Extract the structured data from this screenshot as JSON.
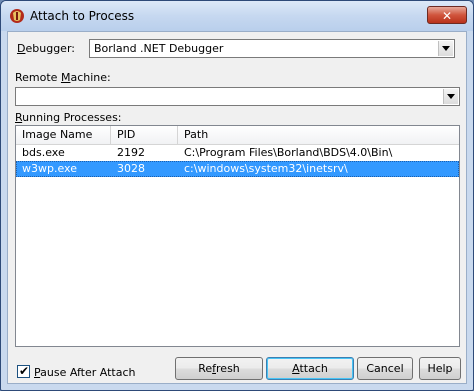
{
  "window": {
    "title": "Attach to Process",
    "close_glyph": "✕"
  },
  "debugger": {
    "label_prefix": "",
    "label_underline": "D",
    "label_rest": "ebugger:",
    "value": "Borland .NET Debugger"
  },
  "remote": {
    "label_prefix": "Remote ",
    "label_underline": "M",
    "label_rest": "achine:",
    "value": ""
  },
  "processes": {
    "label_prefix": "",
    "label_underline": "R",
    "label_rest": "unning Processes:",
    "columns": [
      "Image Name",
      "PID",
      "Path"
    ],
    "rows": [
      {
        "name": "bds.exe",
        "pid": "2192",
        "path": "C:\\Program Files\\Borland\\BDS\\4.0\\Bin\\",
        "selected": false
      },
      {
        "name": "w3wp.exe",
        "pid": "3028",
        "path": "c:\\windows\\system32\\inetsrv\\",
        "selected": true
      }
    ]
  },
  "pause": {
    "checked": true,
    "check_glyph": "✔",
    "label_prefix": "",
    "label_underline": "P",
    "label_rest": "ause After Attach"
  },
  "buttons": {
    "refresh": {
      "prefix": "Re",
      "underline": "f",
      "rest": "resh"
    },
    "attach": {
      "prefix": "",
      "underline": "A",
      "rest": "ttach"
    },
    "cancel": {
      "label": "Cancel"
    },
    "help": {
      "label": "Help"
    }
  },
  "colors": {
    "selection": "#3399ff",
    "close": "#c8432b"
  }
}
